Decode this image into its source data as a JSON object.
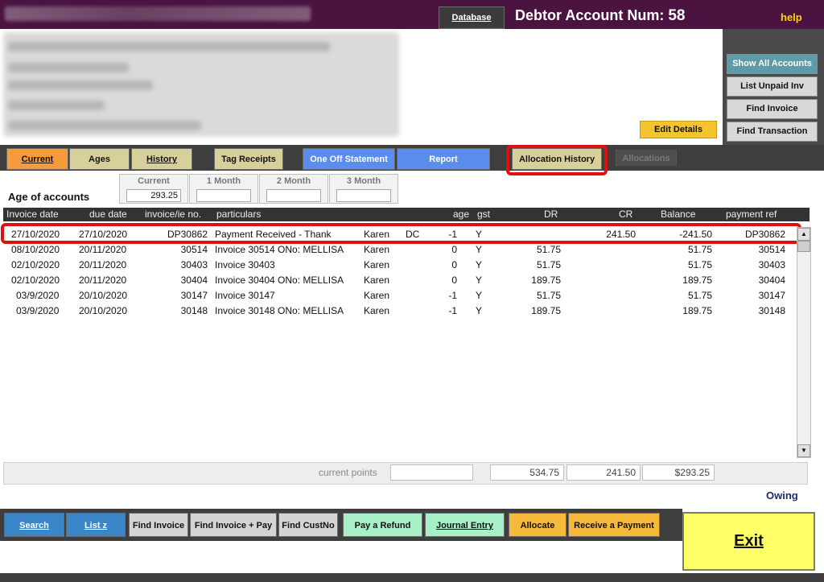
{
  "header": {
    "database_label": "Database",
    "account_label": "Debtor Account Num:",
    "account_number": "58",
    "help_label": "help"
  },
  "right_buttons": {
    "show_all": "Show All Accounts",
    "list_unpaid": "List Unpaid Inv",
    "find_invoice": "Find Invoice",
    "find_transaction": "Find Transaction"
  },
  "edit_details": "Edit Details",
  "tabs": {
    "current": "Current",
    "ages": "Ages",
    "history": "History",
    "tag_receipts": "Tag Receipts",
    "one_off_statement": "One Off Statement",
    "report": "Report",
    "allocation_history": "Allocation History",
    "allocations": "Allocations"
  },
  "ages": {
    "title": "Age of accounts",
    "boxes": [
      {
        "label": "Current",
        "value": "293.25"
      },
      {
        "label": "1 Month",
        "value": ""
      },
      {
        "label": "2 Month",
        "value": ""
      },
      {
        "label": "3 Month",
        "value": ""
      }
    ]
  },
  "table": {
    "columns": [
      "Invoice date",
      "due date",
      "invoice/ie no.",
      "particulars",
      "age",
      "gst",
      "DR",
      "CR",
      "Balance",
      "payment ref"
    ],
    "rows": [
      {
        "invoice_date": "27/10/2020",
        "due_date": "27/10/2020",
        "invoice_no": "DP30862",
        "particulars": "Payment Received - Thank",
        "staff": "Karen",
        "code": "DC",
        "age": "-1",
        "gst": "Y",
        "dr": "",
        "cr": "241.50",
        "balance": "-241.50",
        "payment_ref": "DP30862"
      },
      {
        "invoice_date": "08/10/2020",
        "due_date": "20/11/2020",
        "invoice_no": "30514",
        "particulars": "Invoice 30514 ONo: MELLISA",
        "staff": "Karen",
        "code": "",
        "age": "0",
        "gst": "Y",
        "dr": "51.75",
        "cr": "",
        "balance": "51.75",
        "payment_ref": "30514"
      },
      {
        "invoice_date": "02/10/2020",
        "due_date": "20/11/2020",
        "invoice_no": "30403",
        "particulars": "Invoice 30403",
        "staff": "Karen",
        "code": "",
        "age": "0",
        "gst": "Y",
        "dr": "51.75",
        "cr": "",
        "balance": "51.75",
        "payment_ref": "30403"
      },
      {
        "invoice_date": "02/10/2020",
        "due_date": "20/11/2020",
        "invoice_no": "30404",
        "particulars": "Invoice 30404 ONo: MELLISA",
        "staff": "Karen",
        "code": "",
        "age": "0",
        "gst": "Y",
        "dr": "189.75",
        "cr": "",
        "balance": "189.75",
        "payment_ref": "30404"
      },
      {
        "invoice_date": "03/9/2020",
        "due_date": "20/10/2020",
        "invoice_no": "30147",
        "particulars": "Invoice 30147",
        "staff": "Karen",
        "code": "",
        "age": "-1",
        "gst": "Y",
        "dr": "51.75",
        "cr": "",
        "balance": "51.75",
        "payment_ref": "30147"
      },
      {
        "invoice_date": "03/9/2020",
        "due_date": "20/10/2020",
        "invoice_no": "30148",
        "particulars": "Invoice 30148 ONo: MELLISA",
        "staff": "Karen",
        "code": "",
        "age": "-1",
        "gst": "Y",
        "dr": "189.75",
        "cr": "",
        "balance": "189.75",
        "payment_ref": "30148"
      }
    ]
  },
  "totals": {
    "current_points_label": "current points",
    "current_points": "",
    "dr_total": "534.75",
    "cr_total": "241.50",
    "balance_total": "$293.25",
    "owing_label": "Owing"
  },
  "bottom_buttons": {
    "search": "Search",
    "list_z": "List z",
    "find_invoice": "Find Invoice",
    "find_invoice_pay": "Find Invoice + Pay",
    "find_custno": "Find CustNo",
    "pay_refund": "Pay a Refund",
    "journal_entry": "Journal Entry",
    "allocate": "Allocate",
    "receive_payment": "Receive a Payment",
    "exit": "Exit"
  },
  "colors": {
    "header_bg": "#4a1340",
    "tab_orange": "#f79a3c",
    "tab_khaki": "#d8d09a",
    "tab_blue": "#5b8def",
    "highlight_red": "#e01010",
    "exit_yellow": "#ffff66"
  }
}
